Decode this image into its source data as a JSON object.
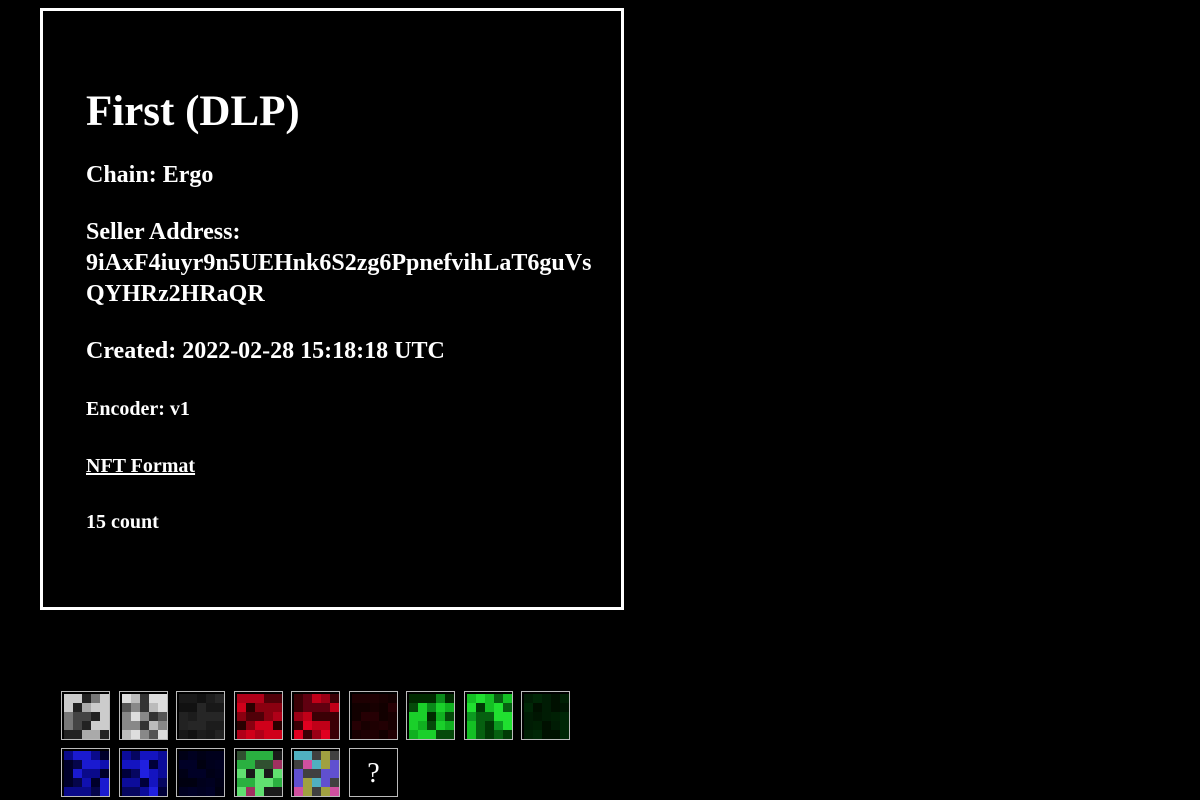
{
  "card": {
    "title": "First (DLP)",
    "chain": "Chain: Ergo",
    "seller_label": "Seller Address:",
    "seller_address": "9iAxF4iuyr9n5UEHnk6S2zg6PpnefvihLaT6guVsQYHRz2HRaQR",
    "created": "Created: 2022-02-28 15:18:18 UTC",
    "encoder": "Encoder: v1",
    "format_link": "NFT Format",
    "count": "15 count"
  },
  "thumbnails": [
    {
      "name": "thumb-gray-1",
      "palette": [
        "#222222",
        "#777777",
        "#cccccc",
        "#444444",
        "#aaaaaa"
      ]
    },
    {
      "name": "thumb-gray-2",
      "palette": [
        "#333333",
        "#888888",
        "#dddddd",
        "#555555",
        "#bbbbbb"
      ]
    },
    {
      "name": "thumb-gray-dark",
      "palette": [
        "#111111",
        "#1c1c1c",
        "#262626",
        "#181818",
        "#222222"
      ]
    },
    {
      "name": "thumb-red-1",
      "palette": [
        "#2a0000",
        "#8a0010",
        "#d0001a",
        "#500008",
        "#b00018"
      ]
    },
    {
      "name": "thumb-red-2",
      "palette": [
        "#3a0005",
        "#9a0015",
        "#e00020",
        "#600010",
        "#c00018"
      ]
    },
    {
      "name": "thumb-red-dark",
      "palette": [
        "#120000",
        "#1e0002",
        "#260004",
        "#180001",
        "#220003"
      ]
    },
    {
      "name": "thumb-green-1",
      "palette": [
        "#002a00",
        "#0a8a1a",
        "#1ad02a",
        "#054a0a",
        "#10b020"
      ]
    },
    {
      "name": "thumb-green-2",
      "palette": [
        "#003a05",
        "#0c9a20",
        "#20e030",
        "#066010",
        "#14c024"
      ]
    },
    {
      "name": "thumb-green-dark",
      "palette": [
        "#001000",
        "#001c04",
        "#002606",
        "#001602",
        "#002004"
      ]
    },
    {
      "name": "thumb-blue-1",
      "palette": [
        "#00002a",
        "#0a0a8a",
        "#1a1ad0",
        "#05054a",
        "#1010b0"
      ]
    },
    {
      "name": "thumb-blue-2",
      "palette": [
        "#00003a",
        "#0c0c9a",
        "#2020e0",
        "#060660",
        "#1414c0"
      ]
    },
    {
      "name": "thumb-blue-dark",
      "palette": [
        "#000010",
        "#00001c",
        "#000026",
        "#000016",
        "#000020"
      ]
    },
    {
      "name": "thumb-mixed-1",
      "palette": [
        "#1a1a1a",
        "#2ab040",
        "#60e070",
        "#a03060",
        "#305030"
      ]
    },
    {
      "name": "thumb-mixed-2",
      "palette": [
        "#404040",
        "#d050a0",
        "#50b0c0",
        "#a0a040",
        "#6050d0"
      ]
    },
    {
      "name": "thumb-unknown",
      "symbol": "?"
    }
  ]
}
